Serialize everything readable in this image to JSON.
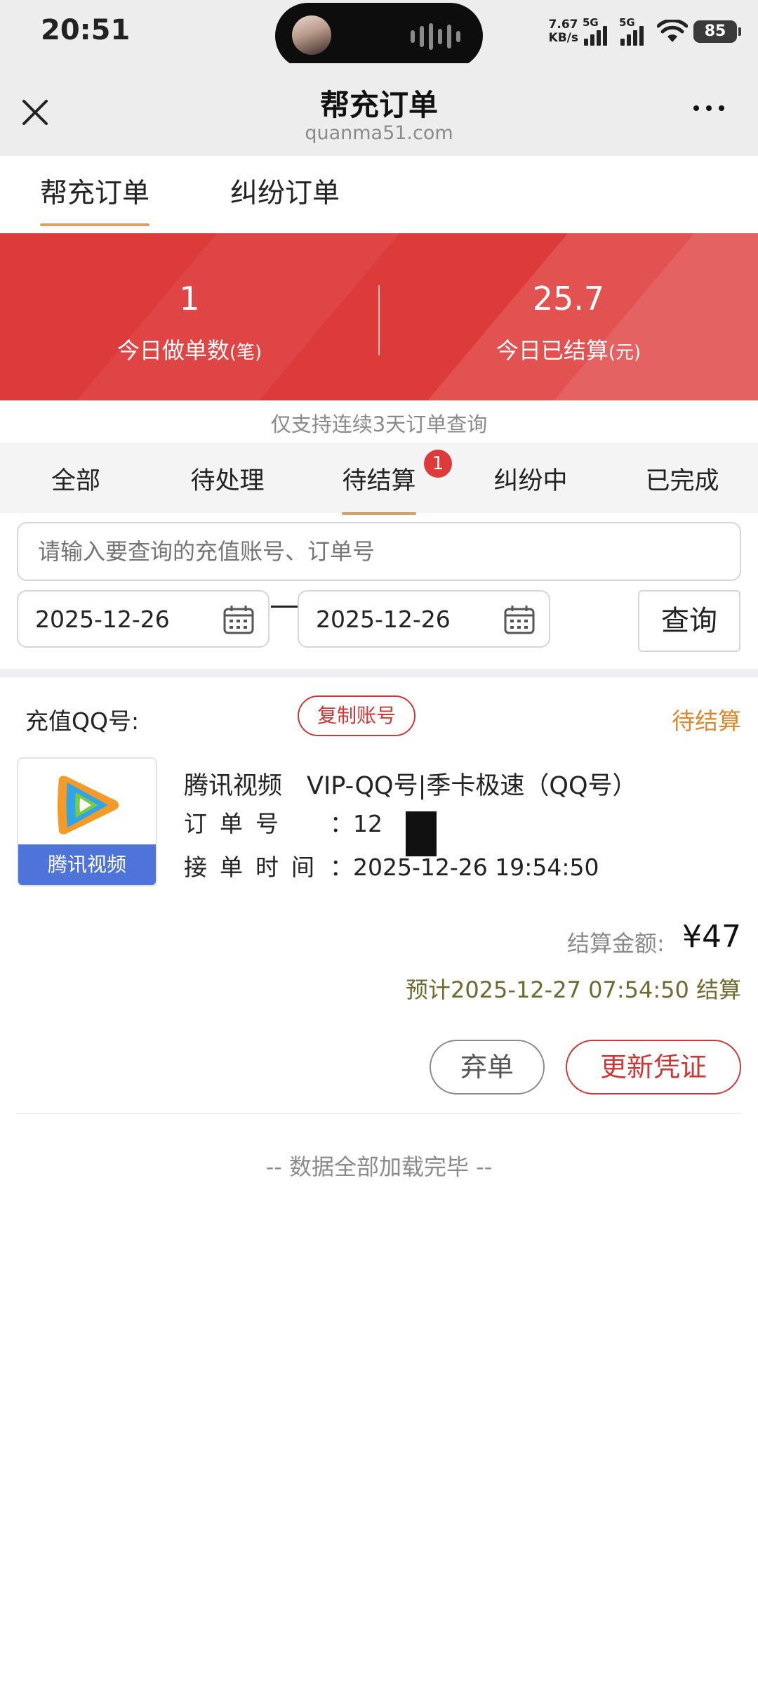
{
  "status_bar": {
    "time": "20:51",
    "net_speed_value": "7.67",
    "net_speed_unit": "KB/s",
    "signal1_label": "5G",
    "signal2_label": "5G",
    "battery": "85"
  },
  "header": {
    "title": "帮充订单",
    "url": "quanma51.com",
    "close_icon": "close-icon",
    "more_icon": "more-icon"
  },
  "top_tabs": [
    {
      "label": "帮充订单",
      "active": true
    },
    {
      "label": "纠纷订单",
      "active": false
    }
  ],
  "stats": {
    "orders_today_value": "1",
    "orders_today_label": "今日做单数",
    "orders_today_unit": "(笔)",
    "settled_today_value": "25.7",
    "settled_today_label": "今日已结算",
    "settled_today_unit": "(元)"
  },
  "notice": "仅支持连续3天订单查询",
  "status_tabs": [
    {
      "label": "全部",
      "active": false
    },
    {
      "label": "待处理",
      "active": false
    },
    {
      "label": "待结算",
      "active": true,
      "badge": "1"
    },
    {
      "label": "纠纷中",
      "active": false
    },
    {
      "label": "已完成",
      "active": false
    }
  ],
  "search": {
    "placeholder": "请输入要查询的充值账号、订单号",
    "start_date": "2025-12-26",
    "end_date": "2025-12-26",
    "query_label": "查询"
  },
  "order": {
    "account_label": "充值QQ号:",
    "copy_label": "复制账号",
    "status": "待结算",
    "app_name": "腾讯视频",
    "product_title": "腾讯视频　VIP-QQ号|季卡极速（QQ号）",
    "order_no_label": "订单号",
    "order_no_value": "：12",
    "accept_time_label": "接单时间",
    "accept_time_value": "：2025-12-26 19:54:50",
    "amount_label": "结算金额:",
    "amount_value": "¥47",
    "eta": "预计2025-12-27 07:54:50 结算",
    "abandon_label": "弃单",
    "update_label": "更新凭证"
  },
  "footer_msg": "-- 数据全部加载完毕 --",
  "colors": {
    "brand_red": "#dd3b3a",
    "tab_underline": "#d9a066",
    "pending_status": "#d98a2f"
  }
}
